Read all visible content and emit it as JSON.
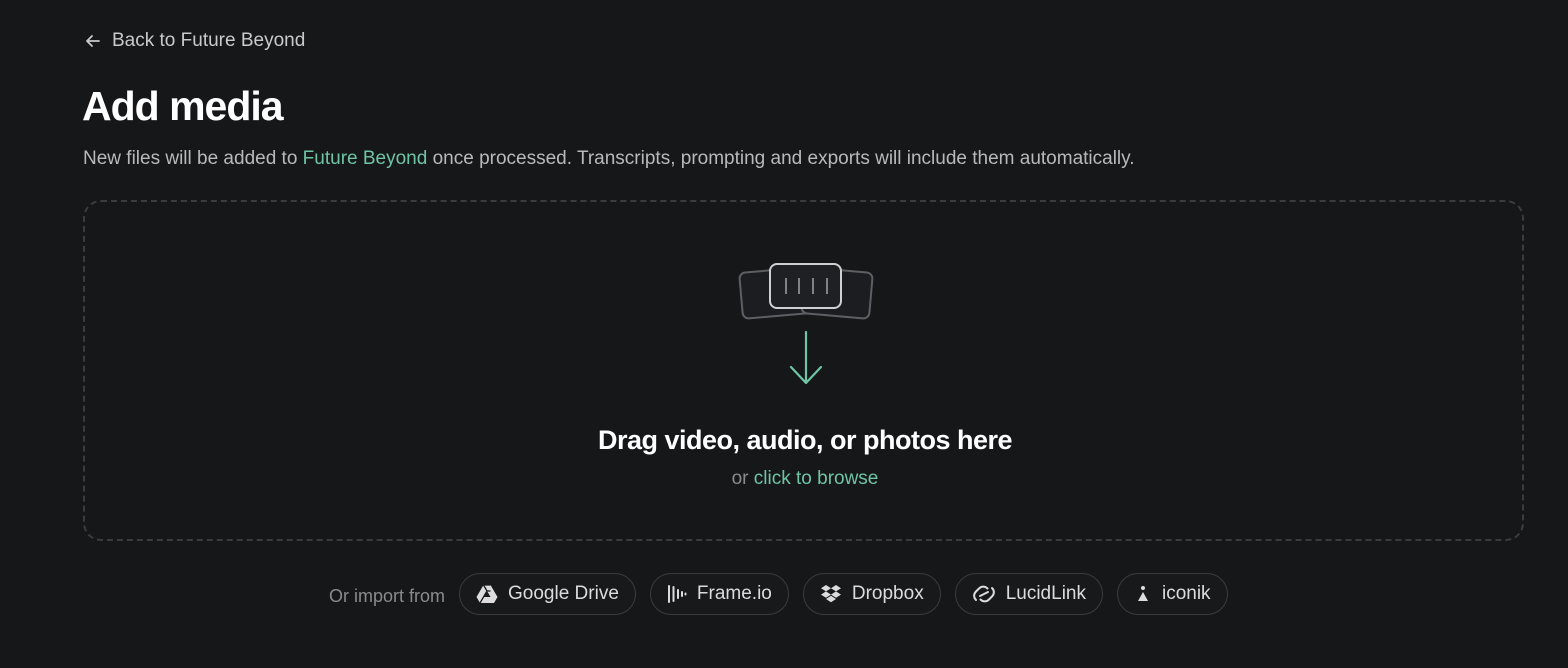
{
  "nav": {
    "back_label": "Back to Future Beyond"
  },
  "header": {
    "title": "Add media",
    "subtitle_prefix": "New files will be added to ",
    "project_name": "Future Beyond",
    "subtitle_suffix": " once processed. Transcripts, prompting and exports will include them automatically."
  },
  "dropzone": {
    "heading": "Drag video, audio, or photos here",
    "or_text": "or ",
    "browse_label": "click to browse"
  },
  "import": {
    "label": "Or import from",
    "sources": [
      {
        "label": "Google Drive",
        "icon": "google-drive-icon"
      },
      {
        "label": "Frame.io",
        "icon": "frameio-icon"
      },
      {
        "label": "Dropbox",
        "icon": "dropbox-icon"
      },
      {
        "label": "LucidLink",
        "icon": "lucidlink-icon"
      },
      {
        "label": "iconik",
        "icon": "iconik-icon"
      }
    ]
  },
  "colors": {
    "background": "#161719",
    "accent": "#6fc4a3",
    "border": "#3a3c40",
    "muted_text": "#8a8b8e"
  }
}
